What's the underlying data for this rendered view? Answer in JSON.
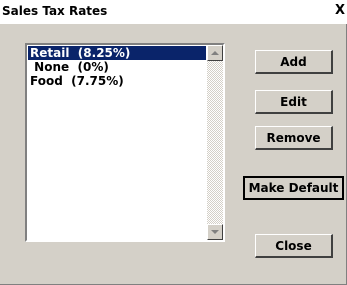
{
  "window": {
    "title": "Sales Tax Rates",
    "close_glyph": "X"
  },
  "tax_list": {
    "selected_index": 0,
    "items": [
      "Retail  (8.25%)",
      " None  (0%)",
      "Food  (7.75%)"
    ],
    "icons": {
      "up": "scroll-up-arrow-icon",
      "down": "scroll-down-arrow-icon"
    }
  },
  "buttons": {
    "add": "Add",
    "edit": "Edit",
    "remove": "Remove",
    "make_default": "Make Default",
    "close": "Close"
  },
  "colors": {
    "dialog_face": "#d4d0c8",
    "selection": "#0a246a"
  }
}
